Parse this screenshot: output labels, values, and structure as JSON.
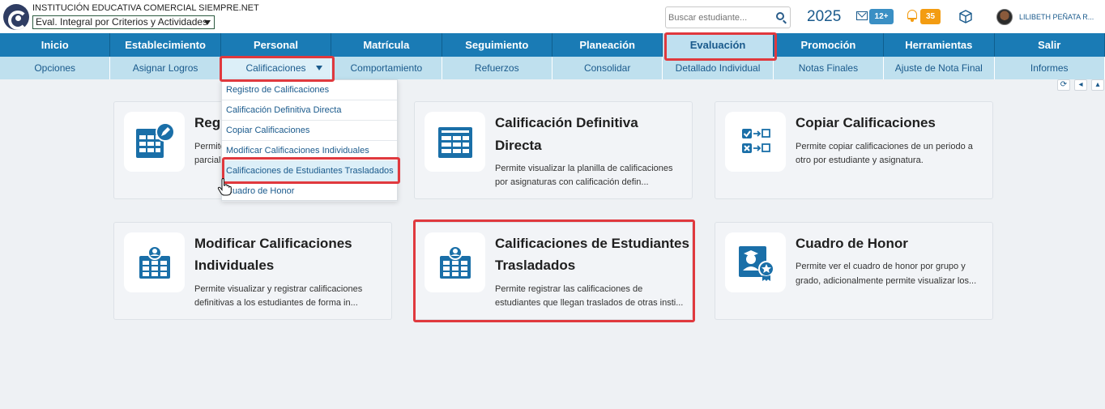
{
  "header": {
    "institution_name": "INSTITUCIÓN EDUCATIVA COMERCIAL SIEMPRE.NET",
    "profile_select": "Eval. Integral por Criterios y Actividades",
    "search_placeholder": "Buscar estudiante...",
    "year": "2025",
    "messages_badge": "12+",
    "notifications_badge": "35",
    "user_name": "LILIBETH PEÑATA R..."
  },
  "main_nav": [
    {
      "label": "Inicio"
    },
    {
      "label": "Establecimiento"
    },
    {
      "label": "Personal"
    },
    {
      "label": "Matrícula"
    },
    {
      "label": "Seguimiento"
    },
    {
      "label": "Planeación"
    },
    {
      "label": "Evaluación",
      "active": true
    },
    {
      "label": "Promoción"
    },
    {
      "label": "Herramientas"
    },
    {
      "label": "Salir"
    }
  ],
  "sub_nav": [
    {
      "label": "Opciones"
    },
    {
      "label": "Asignar Logros"
    },
    {
      "label": "Calificaciones",
      "active": true
    },
    {
      "label": "Comportamiento"
    },
    {
      "label": "Refuerzos"
    },
    {
      "label": "Consolidar"
    },
    {
      "label": "Detallado Individual"
    },
    {
      "label": "Notas Finales"
    },
    {
      "label": "Ajuste de Nota Final"
    },
    {
      "label": "Informes"
    }
  ],
  "dropdown": [
    {
      "label": "Registro de Calificaciones"
    },
    {
      "label": "Calificación Definitiva Directa"
    },
    {
      "label": "Copiar Calificaciones"
    },
    {
      "label": "Modificar Calificaciones Individuales"
    },
    {
      "label": "Calificaciones de Estudiantes Trasladados",
      "selected": true
    },
    {
      "label": "Cuadro de Honor"
    }
  ],
  "cards": [
    {
      "title_line1": "Regi",
      "title_line2": "",
      "desc_line1": "Permite",
      "desc_line2": "parcial",
      "icon": "grade-sheet-edit-icon"
    },
    {
      "title_line1": "Calificación Definitiva",
      "title_line2": "Directa",
      "desc_line1": "Permite visualizar la planilla de calificaciones",
      "desc_line2": "por asignaturas con calificación defin...",
      "icon": "checklist-sheet-icon"
    },
    {
      "title_line1": "Copiar Calificaciones",
      "title_line2": "",
      "desc_line1": "Permite copiar calificaciones de un periodo a",
      "desc_line2": "otro por estudiante y asignatura.",
      "icon": "copy-check-icon"
    },
    {
      "title_line1": "Modificar Calificaciones",
      "title_line2": "Individuales",
      "desc_line1": "Permite visualizar y registrar calificaciones",
      "desc_line2": "definitivas a los estudiantes de forma in...",
      "icon": "student-grade-sheet-icon"
    },
    {
      "title_line1": "Calificaciones de Estudiantes",
      "title_line2": "Trasladados",
      "desc_line1": "Permite registrar las calificaciones de",
      "desc_line2": "estudiantes que llegan traslados de otras insti...",
      "icon": "transferred-student-sheet-icon"
    },
    {
      "title_line1": "Cuadro de Honor",
      "title_line2": "",
      "desc_line1": "Permite ver el cuadro de honor por grupo y",
      "desc_line2": "grado, adicionalmente permite visualizar los...",
      "icon": "honor-certificate-icon"
    }
  ],
  "colors": {
    "nav_bg": "#1a7bb5",
    "subnav_bg": "#bfe0ee",
    "highlight": "#e0393e",
    "icon_blue": "#1a6fa8"
  }
}
